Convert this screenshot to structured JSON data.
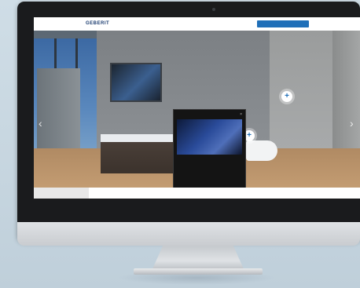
{
  "header": {
    "logo_text": "GEBERIT",
    "cta_label": "",
    "bg_color": "#ffffff",
    "accent_color": "#1f6fb8"
  },
  "scene": {
    "heading_right": "",
    "heading_left": "",
    "nav_prev_glyph": "‹",
    "nav_next_glyph": "›"
  },
  "popup": {
    "title": "",
    "close_glyph": "×",
    "body_text": "",
    "link_label": ""
  },
  "hotspots": [
    {
      "name": "hotspot-plus-1",
      "glyph": "+"
    },
    {
      "name": "hotspot-plus-2",
      "glyph": "+"
    }
  ],
  "icons": {
    "close": "close-icon",
    "plus": "plus-icon",
    "arrow_left": "chevron-left-icon",
    "arrow_right": "chevron-right-icon"
  }
}
